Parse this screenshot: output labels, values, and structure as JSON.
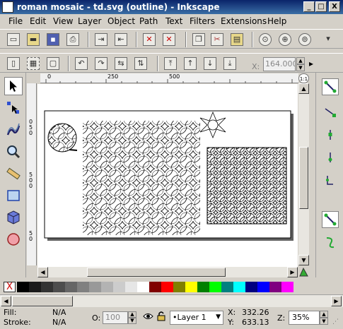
{
  "window": {
    "title": "roman mosaic - td.svg (outline) - Inkscape",
    "minimize_glyph": "_",
    "maximize_glyph": "□",
    "close_glyph": "X"
  },
  "menu": [
    "File",
    "Edit",
    "View",
    "Layer",
    "Object",
    "Path",
    "Text",
    "Filters",
    "Extensions",
    "Help"
  ],
  "command_bar": [
    "new-icon",
    "open-icon",
    "save-icon",
    "print-icon",
    "import-icon",
    "export-icon",
    "undo-icon",
    "redo-icon",
    "copy-icon",
    "cut-icon",
    "paste-icon",
    "zoom-selection-icon",
    "zoom-drawing-icon",
    "zoom-page-icon",
    "more-chevron-icon"
  ],
  "controls_bar": {
    "x_label": "X:",
    "x_value": "164.000",
    "spin_up": "▲",
    "spin_down": "▼"
  },
  "rulers": {
    "horizontal": [
      "0",
      "250",
      "500"
    ],
    "vertical": [
      "0",
      "5",
      "0",
      "5",
      "0",
      "0",
      "5",
      "0"
    ]
  },
  "tools": [
    "selector-tool-icon",
    "node-tool-icon",
    "tweak-tool-icon",
    "zoom-tool-icon",
    "measure-tool-icon",
    "rect-tool-icon",
    "3dbox-tool-icon",
    "circle-tool-icon"
  ],
  "snap_bar": [
    "snap-toggle-icon",
    "snap-nodes-icon",
    "snap-paths-icon",
    "snap-intersections-icon",
    "snap-midpoints-icon",
    "snap-bbox-icon",
    "snap-guide-icon"
  ],
  "scroll": {
    "up": "▲",
    "down": "▼",
    "left": "◀",
    "right": "▶",
    "zoom_corner": "1:1"
  },
  "palette": {
    "none_label": "X",
    "colors": [
      "#000000",
      "#1a1a1a",
      "#333333",
      "#4d4d4d",
      "#666666",
      "#808080",
      "#999999",
      "#b3b3b3",
      "#cccccc",
      "#e6e6e6",
      "#ffffff",
      "#800000",
      "#ff0000",
      "#808000",
      "#ffff00",
      "#008000",
      "#00ff00",
      "#008080",
      "#00ffff",
      "#000080",
      "#0000ff",
      "#800080",
      "#ff00ff"
    ]
  },
  "status": {
    "fill_label": "Fill:",
    "fill_value": "N/A",
    "stroke_label": "Stroke:",
    "stroke_value": "N/A",
    "opacity_label": "O:",
    "opacity_value": "100",
    "layer": "•Layer 1",
    "x_label": "X:",
    "x_value": "332.26",
    "y_label": "Y:",
    "y_value": "633.13",
    "zoom_label": "Z:",
    "zoom_value": "35%"
  }
}
